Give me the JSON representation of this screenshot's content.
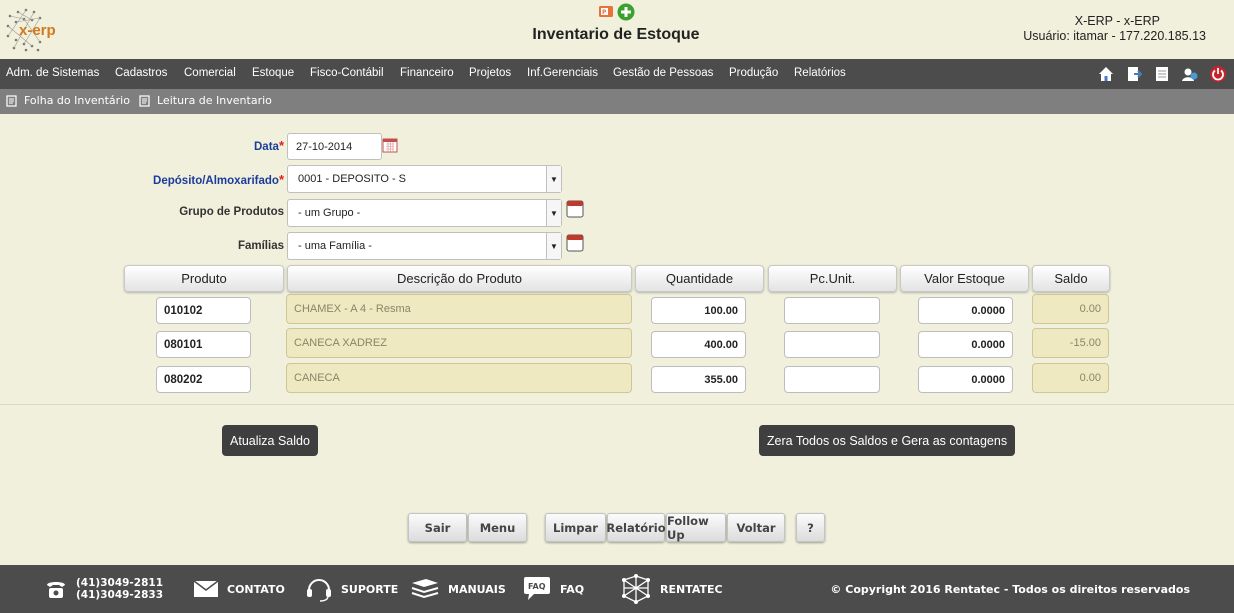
{
  "header": {
    "logo_text": "x-erp",
    "title": "Inventario de Estoque",
    "system_name": "X-ERP - x-ERP",
    "user_line": "Usuário: itamar - 177.220.185.13"
  },
  "menu": {
    "items": [
      "Adm. de Sistemas",
      "Cadastros",
      "Comercial",
      "Estoque",
      "Fisco-Contábil",
      "Financeiro",
      "Projetos",
      "Inf.Gerenciais",
      "Gestão de Pessoas",
      "Produção",
      "Relatórios"
    ],
    "tools": [
      "home-icon",
      "export-icon",
      "document-icon",
      "users-icon",
      "power-icon"
    ]
  },
  "submenu": {
    "items": [
      "Folha do Inventário",
      "Leitura de Inventario"
    ]
  },
  "form": {
    "data_label": "Data",
    "data_value": "27-10-2014",
    "deposito_label": "Depósito/Almoxarifado",
    "deposito_value": "0001 - DEPOSITO - S",
    "grupo_label": "Grupo de Produtos",
    "grupo_value": "- um Grupo -",
    "familias_label": "Famílias",
    "familias_value": "- uma Família -",
    "required_mark": "*"
  },
  "table": {
    "headers": [
      "Produto",
      "Descrição do Produto",
      "Quantidade",
      "Pc.Unit.",
      "Valor Estoque",
      "Saldo"
    ],
    "rows": [
      {
        "produto": "010102",
        "descricao": "CHAMEX - A 4 - Resma",
        "quantidade": "100.00",
        "pc_unit": "",
        "valor": "0.0000",
        "saldo": "0.00"
      },
      {
        "produto": "080101",
        "descricao": "CANECA XADREZ",
        "quantidade": "400.00",
        "pc_unit": "",
        "valor": "0.0000",
        "saldo": "-15.00"
      },
      {
        "produto": "080202",
        "descricao": "CANECA",
        "quantidade": "355.00",
        "pc_unit": "",
        "valor": "0.0000",
        "saldo": "0.00"
      }
    ]
  },
  "actions": {
    "atualiza": "Atualiza Saldo",
    "zera": "Zera Todos os Saldos e Gera as contagens"
  },
  "nav": {
    "sair": "Sair",
    "menu": "Menu",
    "limpar": "Limpar",
    "relatorio": "Relatório",
    "follow_up": "Follow Up",
    "voltar": "Voltar",
    "help": "?"
  },
  "footer": {
    "phone1": "(41)3049-2811",
    "phone2": "(41)3049-2833",
    "contato": "CONTATO",
    "suporte": "SUPORTE",
    "manuais": "MANUAIS",
    "faq": "FAQ",
    "faq_icon_text": "FAQ",
    "rentatec": "RENTATEC",
    "copyright": "© Copyright 2016 Rentatec - Todos os direitos reservados"
  }
}
